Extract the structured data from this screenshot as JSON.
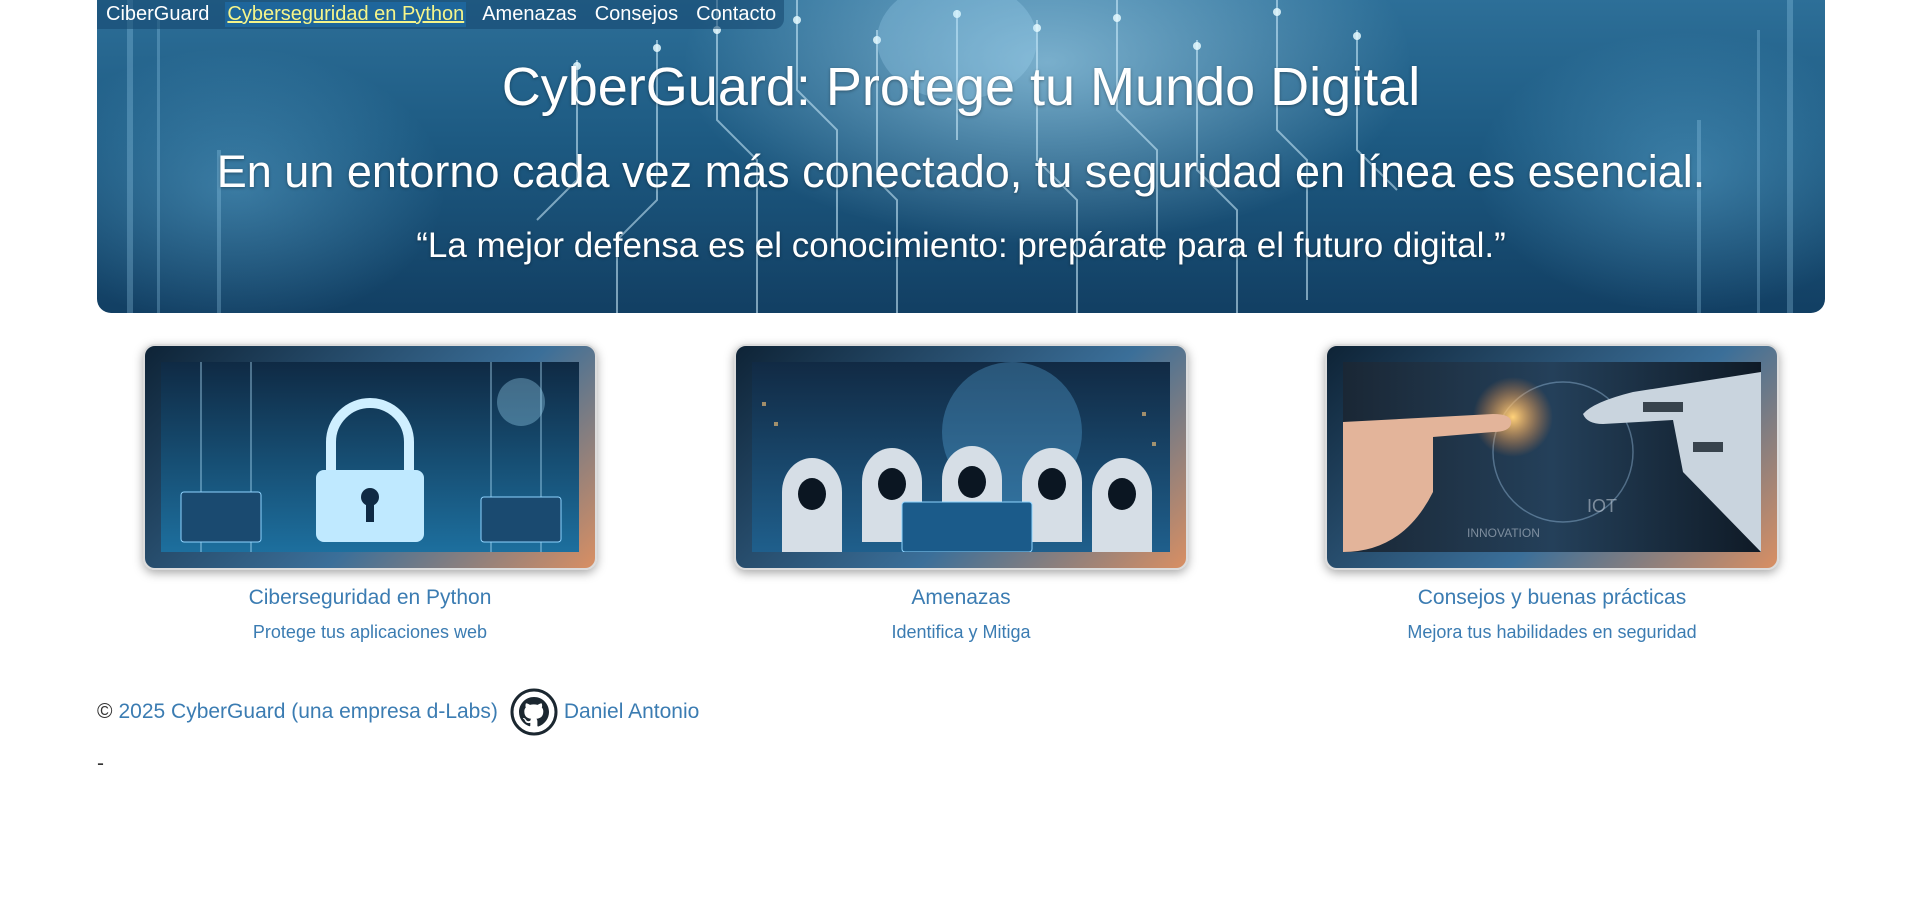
{
  "nav": {
    "brand": "CiberGuard",
    "items": [
      "Cyberseguridad en Python",
      "Amenazas",
      "Consejos",
      "Contacto"
    ]
  },
  "hero": {
    "title": "CyberGuard: Protege tu Mundo Digital",
    "subtitle": "En un entorno cada vez más conectado, tu seguridad en línea es esencial.",
    "quote": "“La mejor defensa es el conocimiento: prepárate para el futuro digital.”"
  },
  "cards": [
    {
      "title": "Ciberseguridad en Python",
      "text": "Protege tus aplicaciones web",
      "image": "padlock-security-image"
    },
    {
      "title": "Amenazas",
      "text": "Identifica y Mitiga",
      "image": "hooded-hackers-image"
    },
    {
      "title": "Consejos y buenas prácticas",
      "text": "Mejora tus habilidades en seguridad",
      "image": "robot-human-hand-image",
      "image_labels": {
        "a": "IOT",
        "b": "INNOVATION"
      }
    }
  ],
  "footer": {
    "copyright": "© ",
    "company": "2025 CyberGuard (una empresa d-Labs)",
    "author": "Daniel Antonio",
    "github_icon": "github-icon",
    "dash": "-"
  },
  "colors": {
    "link": "#3b7cb2",
    "nav_active": "#f6f58a",
    "hero_dark": "#123f63"
  }
}
